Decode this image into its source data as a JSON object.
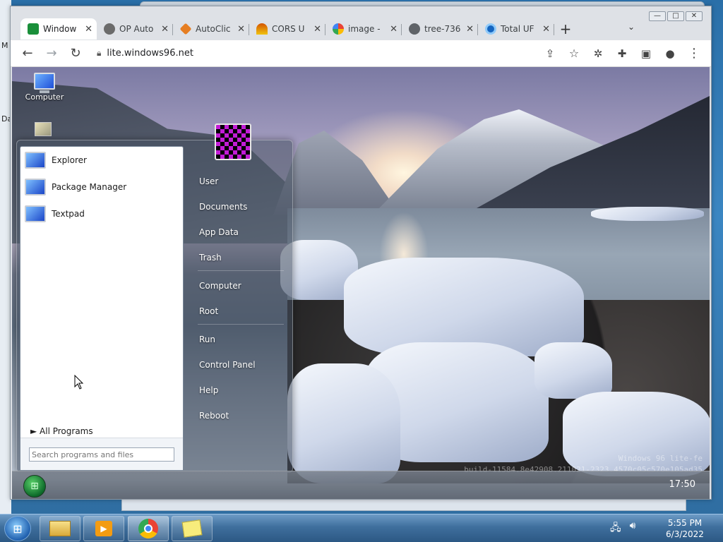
{
  "host": {
    "left_labels": [
      "M",
      "Da"
    ],
    "taskbar": {
      "time": "5:55 PM",
      "date": "6/3/2022",
      "apps": [
        "explorer-icon",
        "media-player-icon",
        "chrome-icon",
        "sticky-notes-icon"
      ]
    }
  },
  "browser": {
    "window_controls": [
      "—",
      "□",
      "✕"
    ],
    "tabs": [
      {
        "title": "Window",
        "color": "#1a8f3a",
        "active": true
      },
      {
        "title": "OP Auto",
        "color": "#6b6b6b",
        "active": false
      },
      {
        "title": "AutoClic",
        "color": "#e67e22",
        "active": false
      },
      {
        "title": "CORS U",
        "color": "#d35400",
        "active": false
      },
      {
        "title": "image -",
        "color": "#4285f4",
        "active": false
      },
      {
        "title": "tree-736",
        "color": "#5f6368",
        "active": false
      },
      {
        "title": "Total UF",
        "color": "#1565c0",
        "active": false
      }
    ],
    "new_tab": "+",
    "tab_dropdown": "⌄",
    "address": "lite.windows96.net"
  },
  "w96": {
    "desktop_icons": [
      {
        "label": "Computer"
      }
    ],
    "start_menu": {
      "programs": [
        "Explorer",
        "Package Manager",
        "Textpad"
      ],
      "all_programs": "► All Programs",
      "search_placeholder": "Search programs and files",
      "right_group1": [
        "User",
        "Documents",
        "App Data",
        "Trash"
      ],
      "right_group2": [
        "Computer",
        "Root"
      ],
      "right_group3": [
        "Run",
        "Control Panel",
        "Help",
        "Reboot"
      ]
    },
    "watermark_line1": "Windows 96 lite-fe",
    "watermark_line2": "build-11584.8e42908.211021-2323.4570c05c570e105ad35",
    "taskbar_time": "17:50"
  }
}
